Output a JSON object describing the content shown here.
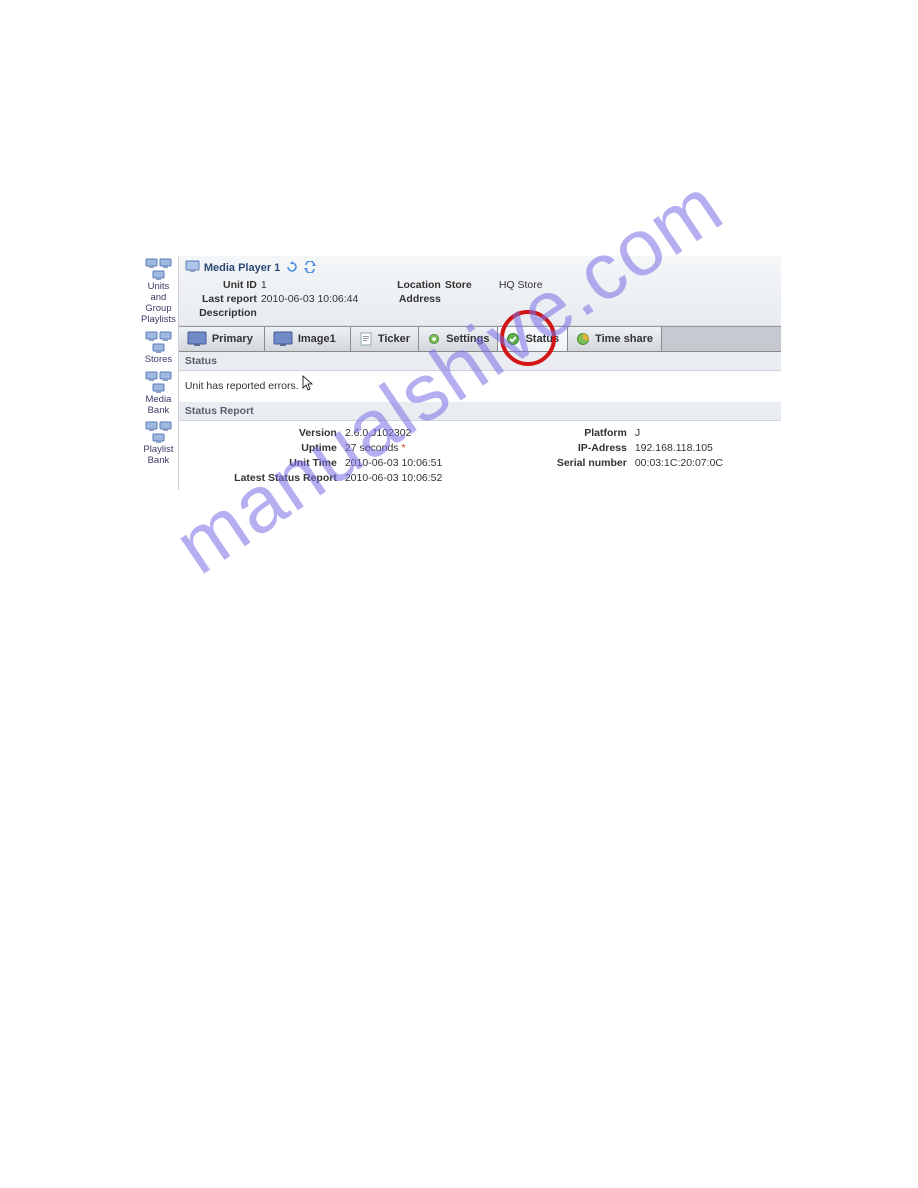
{
  "watermark": "manualshive.com",
  "sidebar": {
    "items": [
      {
        "label": "Units and Group Playlists"
      },
      {
        "label": "Stores"
      },
      {
        "label": "Media Bank"
      },
      {
        "label": "Playlist Bank"
      }
    ]
  },
  "header": {
    "title": "Media Player 1",
    "unit_id_label": "Unit ID",
    "unit_id": "1",
    "location_label": "Location",
    "location": "",
    "store_label": "Store",
    "store": "HQ Store",
    "last_report_label": "Last report",
    "last_report": "2010-06-03 10:06:44",
    "address_label": "Address",
    "address": "",
    "description_label": "Description",
    "description": ""
  },
  "tabs": [
    {
      "label": "Primary",
      "icon": "monitor"
    },
    {
      "label": "Image1",
      "icon": "monitor"
    },
    {
      "label": "Ticker",
      "icon": "page"
    },
    {
      "label": "Settings",
      "icon": "gear"
    },
    {
      "label": "Status",
      "icon": "check",
      "active": true
    },
    {
      "label": "Time share",
      "icon": "pie"
    }
  ],
  "status": {
    "section_label": "Status",
    "message": "Unit has reported errors."
  },
  "report": {
    "section_label": "Status Report",
    "left": {
      "version_label": "Version",
      "version": "2.6.0.J102302",
      "uptime_label": "Uptime",
      "uptime": "27 seconds",
      "uptime_mark": "*",
      "unit_time_label": "Unit Time",
      "unit_time": "2010-06-03 10:06:51",
      "latest_label": "Latest Status Report",
      "latest": "2010-06-03 10:06:52"
    },
    "right": {
      "platform_label": "Platform",
      "platform": "J",
      "ip_label": "IP-Adress",
      "ip": "192.168.118.105",
      "serial_label": "Serial number",
      "serial": "00:03:1C:20:07:0C"
    }
  }
}
